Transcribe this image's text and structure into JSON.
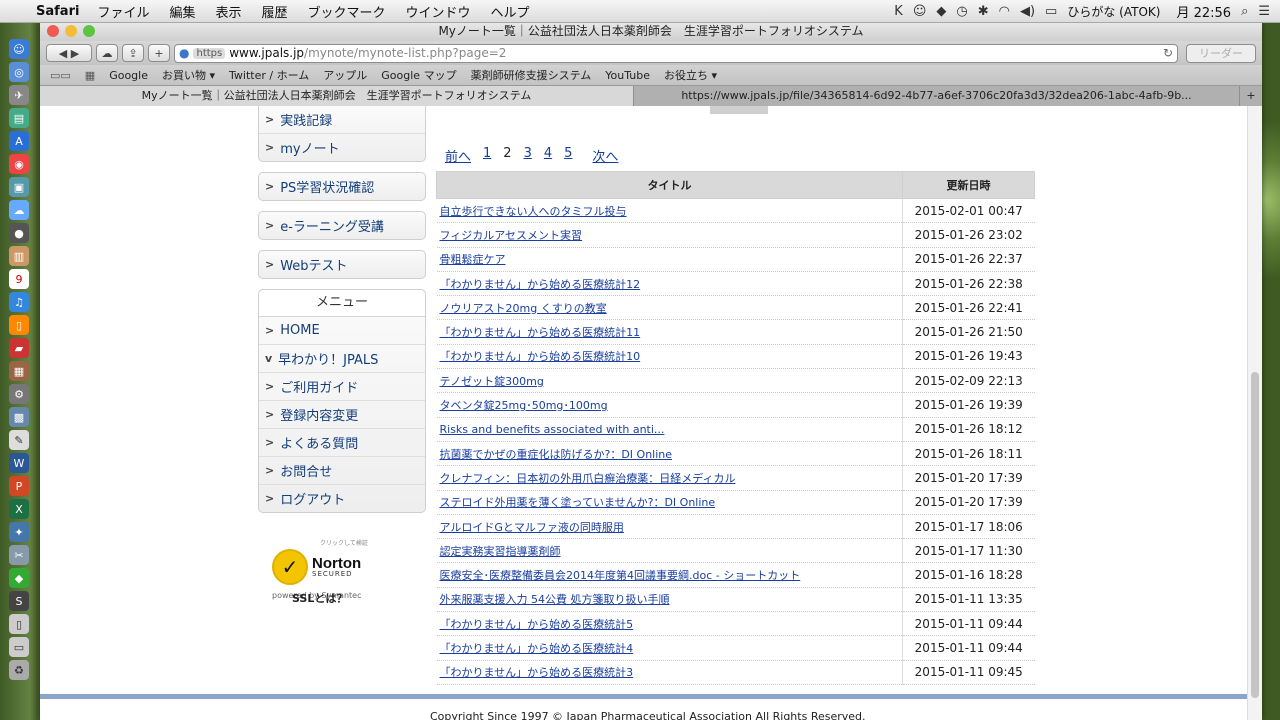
{
  "menubar": {
    "app": "Safari",
    "items": [
      "ファイル",
      "編集",
      "表示",
      "履歴",
      "ブックマーク",
      "ウインドウ",
      "ヘルプ"
    ],
    "ime": "ひらがな (ATOK)",
    "clock": "月 22:56"
  },
  "window": {
    "title": "Myノート一覧｜公益社団法人日本薬剤師会　生涯学習ポートフォリオシステム",
    "url_scheme": "https",
    "url_host": "www.jpals.jp",
    "url_path": "/mynote/mynote-list.php?page=2",
    "reader_label": "リーダー"
  },
  "bookmarks": [
    "Google",
    "お買い物 ▾",
    "Twitter / ホーム",
    "アップル",
    "Google マップ",
    "薬剤師研修支援システム",
    "YouTube",
    "お役立ち ▾"
  ],
  "tabs": {
    "active": "Myノート一覧｜公益社団法人日本薬剤師会　生涯学習ポートフォリオシステム",
    "inactive": "https://www.jpals.jp/file/34365814-6d92-4b77-a6ef-3706c20fa3d3/32dea206-1abc-4afb-9b..."
  },
  "sidebar": {
    "top_items": [
      "実践記録",
      "myノート"
    ],
    "ps_label": "PS学習状況確認",
    "elearning_label": "e-ラーニング受講",
    "webtest_label": "Webテスト",
    "menu_title": "メニュー",
    "menu_items": [
      "HOME",
      "早わかり！JPALS",
      "ご利用ガイド",
      "登録内容変更",
      "よくある質問",
      "お問合せ",
      "ログアウト"
    ],
    "norton_top": "クリックして検証",
    "norton_brand": "Norton",
    "norton_secured": "SECURED",
    "norton_powered": "powered by Symantec",
    "ssl_label": "SSLとは？"
  },
  "pager": {
    "prev": "前へ",
    "pages": [
      "1",
      "2",
      "3",
      "4",
      "5"
    ],
    "current": "2",
    "next": "次へ"
  },
  "table": {
    "headers": [
      "タイトル",
      "更新日時"
    ],
    "rows": [
      {
        "title": "自立歩行できない人へのタミフル投与",
        "date": "2015-02-01 00:47"
      },
      {
        "title": "フィジカルアセスメント実習",
        "date": "2015-01-26 23:02"
      },
      {
        "title": "骨粗鬆症ケア",
        "date": "2015-01-26 22:37"
      },
      {
        "title": "「わかりません」から始める医療統計12",
        "date": "2015-01-26 22:38"
      },
      {
        "title": "ノウリアスト20mg くすりの教室",
        "date": "2015-01-26 22:41"
      },
      {
        "title": "「わかりません」から始める医療統計11",
        "date": "2015-01-26 21:50"
      },
      {
        "title": "「わかりません」から始める医療統計10",
        "date": "2015-01-26 19:43"
      },
      {
        "title": "テノゼット錠300mg",
        "date": "2015-02-09 22:13"
      },
      {
        "title": "タベンタ錠25mg･50mg･100mg",
        "date": "2015-01-26 19:39"
      },
      {
        "title": "Risks and benefits associated with anti...",
        "date": "2015-01-26 18:12"
      },
      {
        "title": "抗菌薬でかぜの重症化は防げるか?：DI Online",
        "date": "2015-01-26 18:11"
      },
      {
        "title": "クレナフィン：日本初の外用爪白癬治療薬：日経メディカル",
        "date": "2015-01-20 17:39"
      },
      {
        "title": "ステロイド外用薬を薄く塗っていませんか?：DI Online",
        "date": "2015-01-20 17:39"
      },
      {
        "title": "アルロイドGとマルファ液の同時服用",
        "date": "2015-01-17 18:06"
      },
      {
        "title": "認定実務実習指導薬剤師",
        "date": "2015-01-17 11:30"
      },
      {
        "title": "医療安全･医療整備委員会2014年度第4回議事要綱.doc - ショートカット",
        "date": "2015-01-16 18:28"
      },
      {
        "title": "外来服薬支援入力 54公費 処方箋取り扱い手順",
        "date": "2015-01-11 13:35"
      },
      {
        "title": "「わかりません」から始める医療統計5",
        "date": "2015-01-11 09:44"
      },
      {
        "title": "「わかりません」から始める医療統計4",
        "date": "2015-01-11 09:44"
      },
      {
        "title": "「わかりません」から始める医療統計3",
        "date": "2015-01-11 09:45"
      }
    ]
  },
  "footer": {
    "copyright": "Copyright Since 1997 © Japan Pharmaceutical Association All Rights Reserved."
  }
}
